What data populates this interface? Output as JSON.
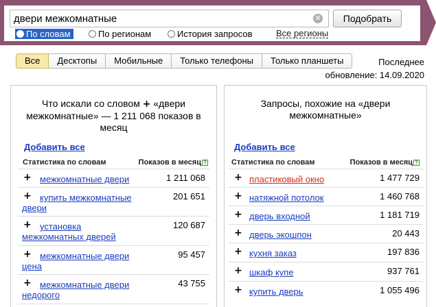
{
  "search": {
    "value": "двери межкомнатные",
    "clear_icon": "✕",
    "submit_label": "Подобрать"
  },
  "modes": [
    {
      "label": "По словам",
      "selected": true
    },
    {
      "label": "По регионам",
      "selected": false
    },
    {
      "label": "История запросов",
      "selected": false
    }
  ],
  "all_regions_label": "Все регионы",
  "tabs": [
    {
      "label": "Все",
      "active": true
    },
    {
      "label": "Десктопы",
      "active": false
    },
    {
      "label": "Мобильные",
      "active": false
    },
    {
      "label": "Только телефоны",
      "active": false
    },
    {
      "label": "Только планшеты",
      "active": false
    }
  ],
  "updated": {
    "line1": "Последнее",
    "line2": "обновление: 14.09.2020"
  },
  "left_panel": {
    "title_prefix": "Что искали со словом",
    "title_plus": "+",
    "title_rest": "«двери межкомнатные» — 1 211 068 показов в месяц",
    "add_all": "Добавить все",
    "col_words": "Статистика по словам",
    "col_shows": "Показов в месяц",
    "help_icon": "?",
    "rows": [
      {
        "plus": "+",
        "line1": "межкомнатные двери",
        "line2": "",
        "count": "1 211 068"
      },
      {
        "plus": "+",
        "line1": "купить межкомнатные",
        "line2": "двери",
        "count": "201 651"
      },
      {
        "plus": "+",
        "line1": "установка",
        "line2": "межкомнатных дверей",
        "count": "120 687"
      },
      {
        "plus": "+",
        "line1": "межкомнатные двери",
        "line2": "цена",
        "count": "95 457"
      },
      {
        "plus": "+",
        "line1": "межкомнатные двери",
        "line2": "недорого",
        "count": "43 755"
      }
    ]
  },
  "right_panel": {
    "title": "Запросы, похожие на «двери межкомнатные»",
    "add_all": "Добавить все",
    "col_words": "Статистика по словам",
    "col_shows": "Показов в месяц",
    "help_icon": "?",
    "rows": [
      {
        "plus": "+",
        "phrase": "пластиковый окно",
        "count": "1 477 729",
        "highlight": true
      },
      {
        "plus": "+",
        "phrase": "натяжной потолок",
        "count": "1 460 768",
        "highlight": false
      },
      {
        "plus": "+",
        "phrase": "дверь входной",
        "count": "1 181 719",
        "highlight": false
      },
      {
        "plus": "+",
        "phrase": "дверь экошпон",
        "count": "20 443",
        "highlight": false
      },
      {
        "plus": "+",
        "phrase": "кухня заказ",
        "count": "197 836",
        "highlight": false
      },
      {
        "plus": "+",
        "phrase": "шкаф купе",
        "count": "937 761",
        "highlight": false
      },
      {
        "plus": "+",
        "phrase": "купить дверь",
        "count": "1 055 496",
        "highlight": false
      }
    ]
  },
  "colors": {
    "header_bg": "#8c5470",
    "link": "#1a3dc1",
    "link_highlight": "#d6281c",
    "active_tab": "#fbe9a8"
  }
}
